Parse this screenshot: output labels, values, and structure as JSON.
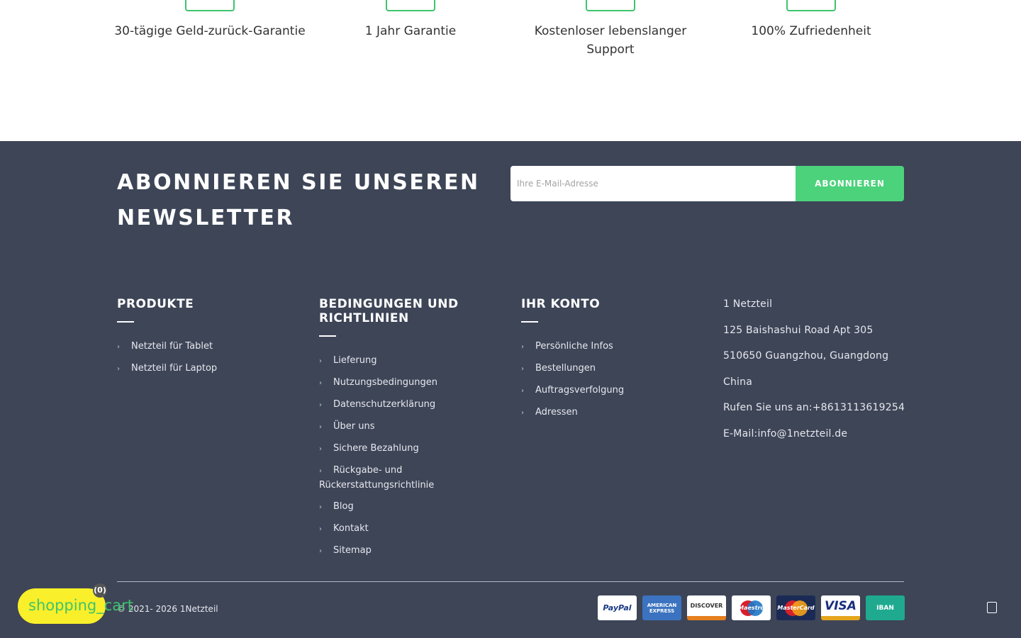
{
  "features": [
    {
      "label": "30-tägige Geld-zurück-Garantie"
    },
    {
      "label": "1 Jahr Garantie"
    },
    {
      "label": "Kostenloser lebenslanger Support"
    },
    {
      "label": "100% Zufriedenheit"
    }
  ],
  "newsletter": {
    "title": "ABONNIEREN SIE UNSEREN NEWSLETTER",
    "placeholder": "Ihre E-Mail-Adresse",
    "button": "ABONNIEREN"
  },
  "columns": {
    "products": {
      "title": "PRODUKTE",
      "items": [
        "Netzteil für Tablet",
        "Netzteil für Laptop"
      ]
    },
    "terms": {
      "title": "BEDINGUNGEN UND RICHTLINIEN",
      "items": [
        "Lieferung",
        "Nutzungsbedingungen",
        "Datenschutzerklärung",
        "Über uns",
        "Sichere Bezahlung",
        "Rückgabe- und Rückerstattungsrichtlinie",
        "Blog",
        "Kontakt",
        "Sitemap"
      ]
    },
    "account": {
      "title": "IHR KONTO",
      "items": [
        "Persönliche Infos",
        "Bestellungen",
        "Auftragsverfolgung",
        "Adressen"
      ]
    }
  },
  "contact": {
    "company": "1 Netzteil",
    "street": "125 Baishashui Road Apt 305",
    "city": "510650 Guangzhou, Guangdong",
    "country": "China",
    "phone": "Rufen Sie uns an:+8613113619254",
    "email": "E-Mail:info@1netzteil.de"
  },
  "copyright": "© 2021- 2026 1Netzteil",
  "payments": {
    "paypal": "PayPal",
    "amex": "AMERICAN EXPRESS",
    "discover": "DISCOVER",
    "maestro": "Maestro",
    "mastercard": "MasterCard",
    "visa": "VISA",
    "iban": "IBAN"
  },
  "cart": {
    "label": "shopping_cart",
    "count": "(0)"
  },
  "colors": {
    "footer_bg": "#3d4557",
    "accent_green": "#4cd27b",
    "cart_yellow": "#f9ef2a"
  }
}
